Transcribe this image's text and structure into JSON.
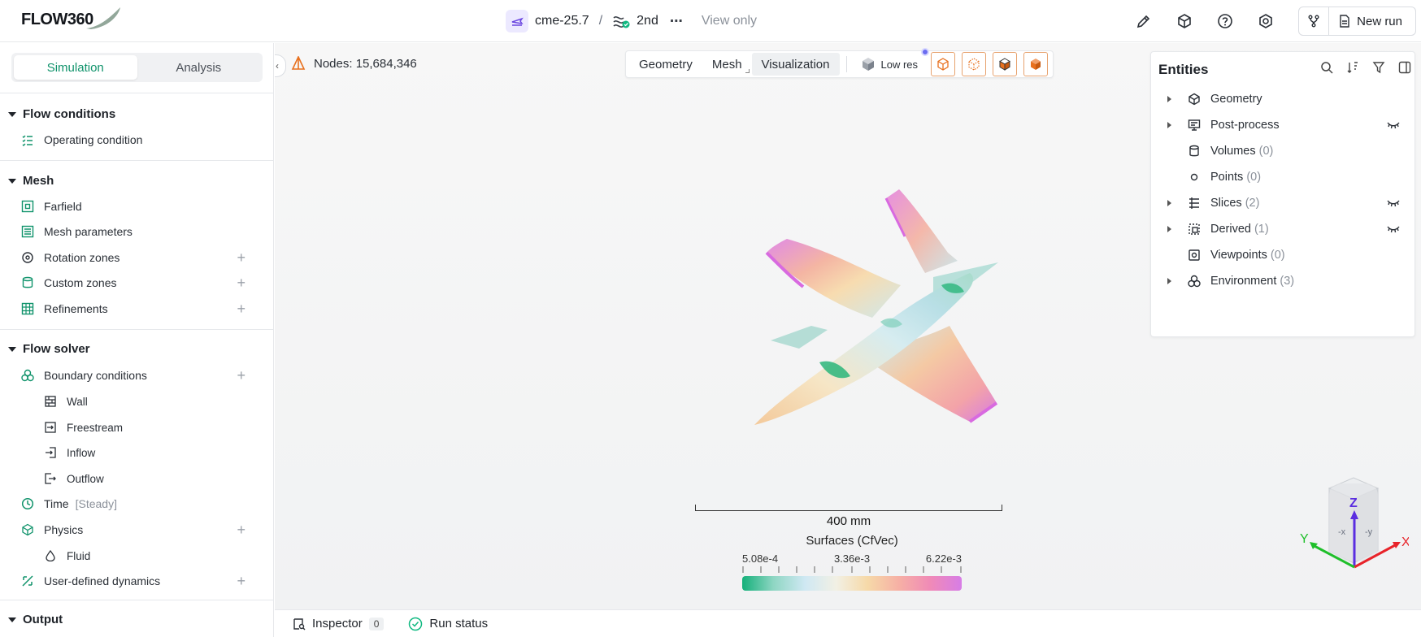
{
  "app": {
    "logo": "FLOW360"
  },
  "breadcrumb": {
    "project": "cme-25.7",
    "case": "2nd",
    "mode": "View only",
    "more": "⋯"
  },
  "toolbar": {
    "new_run": "New run"
  },
  "sidebar": {
    "tabs": {
      "simulation": "Simulation",
      "analysis": "Analysis"
    },
    "flow_conditions": {
      "title": "Flow conditions",
      "items": [
        "Operating condition"
      ]
    },
    "mesh": {
      "title": "Mesh",
      "items": [
        "Farfield",
        "Mesh parameters",
        "Rotation zones",
        "Custom zones",
        "Refinements"
      ]
    },
    "flow_solver": {
      "title": "Flow solver",
      "boundary": "Boundary conditions",
      "bc_items": [
        "Wall",
        "Freestream",
        "Inflow",
        "Outflow"
      ],
      "time": "Time",
      "time_mode": "[Steady]",
      "physics": "Physics",
      "fluid": "Fluid",
      "udd": "User-defined dynamics"
    },
    "output": {
      "title": "Output"
    }
  },
  "viewport": {
    "nodes_label": "Nodes: 15,684,346",
    "tabs": [
      "Geometry",
      "Mesh",
      "Visualization"
    ],
    "active_tab": "Visualization",
    "resolution": "Low res",
    "scale_label": "400 mm",
    "legend": {
      "title": "Surfaces (CfVec)",
      "min": "5.08e-4",
      "mid": "3.36e-3",
      "max": "6.22e-3"
    },
    "axes": {
      "x": "X",
      "y": "Y",
      "z": "Z"
    }
  },
  "entities": {
    "title": "Entities",
    "items": [
      {
        "label": "Geometry",
        "count": ""
      },
      {
        "label": "Post-process",
        "count": ""
      },
      {
        "label": "Volumes",
        "count": "(0)"
      },
      {
        "label": "Points",
        "count": "(0)"
      },
      {
        "label": "Slices",
        "count": "(2)"
      },
      {
        "label": "Derived",
        "count": "(1)"
      },
      {
        "label": "Viewpoints",
        "count": "(0)"
      },
      {
        "label": "Environment",
        "count": "(3)"
      }
    ]
  },
  "bottom": {
    "inspector": "Inspector",
    "inspector_count": "0",
    "run_status": "Run status"
  },
  "colors": {
    "accent": "#10936b",
    "purple": "#6b47e0",
    "orange": "#e8711f"
  }
}
